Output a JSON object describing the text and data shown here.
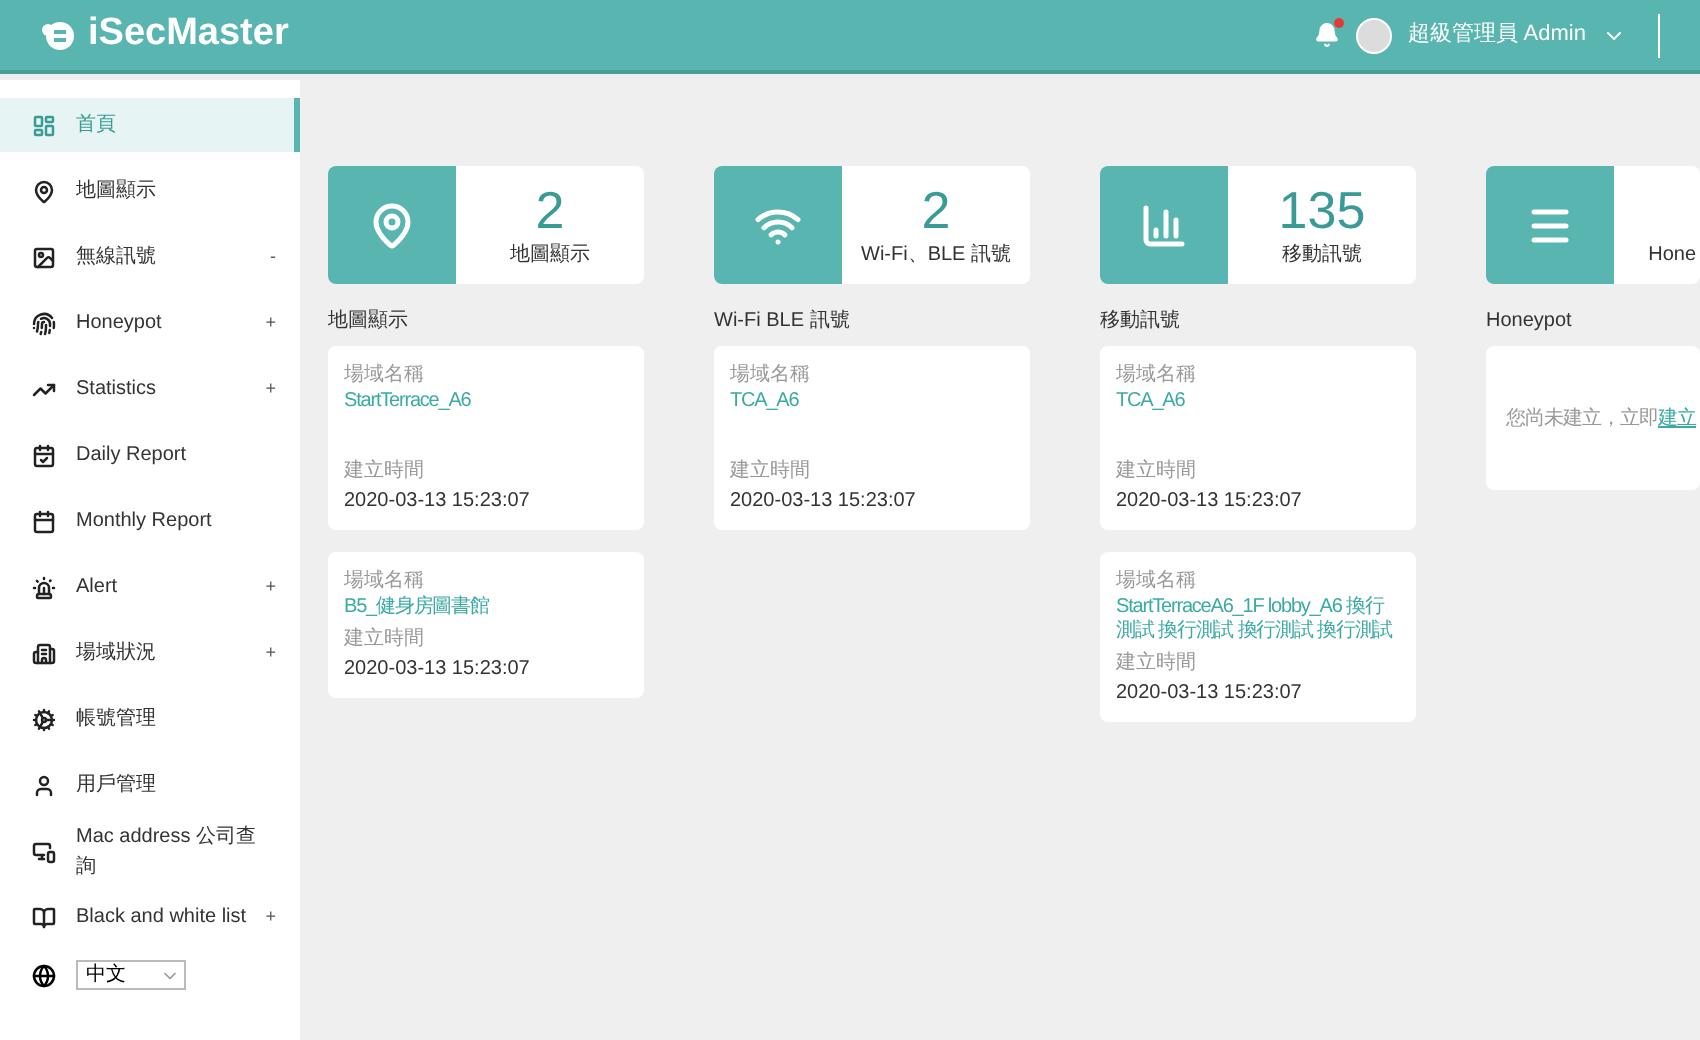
{
  "header": {
    "logo": "iSecMaster",
    "user": "超級管理員 Admin",
    "notification": true
  },
  "sidebar": {
    "items": [
      {
        "label": "首頁",
        "selected": true
      },
      {
        "label": "地圖顯示",
        "selected": false
      },
      {
        "label": "無線訊號",
        "selected": false,
        "expander": "-"
      },
      {
        "label": "Honeypot",
        "selected": false,
        "expander": "+"
      },
      {
        "label": "Statistics",
        "selected": false,
        "expander": "+"
      },
      {
        "label": "Daily Report",
        "selected": false
      },
      {
        "label": "Monthly Report",
        "selected": false
      },
      {
        "label": "Alert",
        "selected": false,
        "expander": "+"
      },
      {
        "label": "場域狀況",
        "selected": false,
        "expander": "+"
      },
      {
        "label": "帳號管理",
        "selected": false
      },
      {
        "label": "用戶管理",
        "selected": false
      },
      {
        "label": "Mac address 公司查詢",
        "selected": false
      },
      {
        "label": "Black and white list",
        "selected": false,
        "expander": "+"
      }
    ],
    "language": "中文"
  },
  "columns": [
    {
      "count": "2",
      "count_label": "地圖顯示",
      "title": "地圖顯示",
      "kind": "records",
      "records": [
        {
          "name_label": "場域名稱",
          "name": "StartTerrace_A6",
          "time_label": "建立時間",
          "time": "2020-03-13 15:23:07"
        },
        {
          "name_label": "場域名稱",
          "name": "B5_健身房圖書館",
          "time_label": "建立時間",
          "time": "2020-03-13 15:23:07"
        }
      ]
    },
    {
      "count": "2",
      "count_label": "Wi-Fi、BLE 訊號",
      "title": "Wi-Fi  BLE 訊號",
      "kind": "records",
      "records": [
        {
          "name_label": "場域名稱",
          "name": "TCA_A6",
          "time_label": "建立時間",
          "time": "2020-03-13 15:23:07"
        }
      ]
    },
    {
      "count": "135",
      "count_label": "移動訊號",
      "title": "移動訊號",
      "kind": "records",
      "records": [
        {
          "name_label": "場域名稱",
          "name": "TCA_A6",
          "time_label": "建立時間",
          "time": "2020-03-13 15:23:07"
        },
        {
          "name_label": "場域名稱",
          "name": "StartTerraceA6_1F lobby_A6 換行測試 換行測試 換行測試 換行測試",
          "time_label": "建立時間",
          "time": "2020-03-13 15:23:07"
        }
      ]
    },
    {
      "count_label": "Hone",
      "title": "Honeypot",
      "kind": "empty",
      "message": "您尚未建立，立即",
      "link": "建立"
    }
  ]
}
